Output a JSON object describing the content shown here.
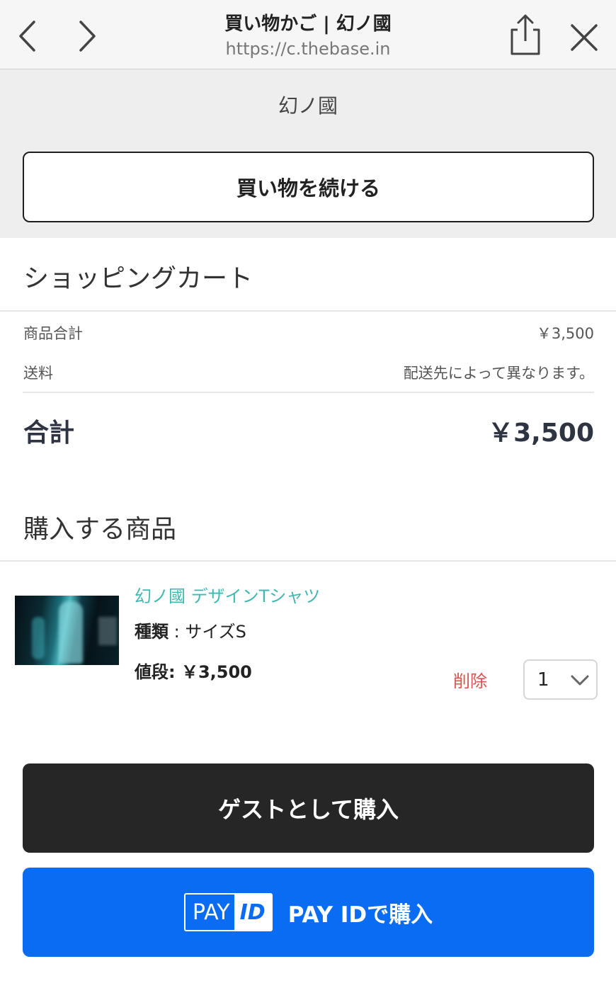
{
  "browser": {
    "title": "買い物かご | 幻ノ國",
    "url": "https://c.thebase.in"
  },
  "shop": {
    "name": "幻ノ國",
    "continue_label": "買い物を続ける"
  },
  "cart": {
    "title": "ショッピングカート",
    "subtotal_label": "商品合計",
    "subtotal_value": "￥3,500",
    "shipping_label": "送料",
    "shipping_value": "配送先によって異なります。",
    "total_label": "合計",
    "total_value": "￥3,500"
  },
  "items_section": {
    "title": "購入する商品",
    "items": [
      {
        "name": "幻ノ國 デザインTシャツ",
        "variant_key": "種類",
        "variant_value": "サイズS",
        "price_label": "値段:",
        "price_value": "￥3,500",
        "delete_label": "削除",
        "quantity": "1"
      }
    ]
  },
  "actions": {
    "guest_label": "ゲストとして購入",
    "payid_logo_pay": "PAY",
    "payid_logo_id": "ID",
    "payid_label": "PAY IDで購入"
  },
  "colors": {
    "accent_item_link": "#3fb8b0",
    "delete_red": "#d9534f",
    "payid_blue": "#0a6cf2",
    "guest_button": "#262626"
  },
  "icons": [
    "chevron-left-icon",
    "chevron-right-icon",
    "share-icon",
    "close-icon",
    "chevron-down-icon"
  ]
}
